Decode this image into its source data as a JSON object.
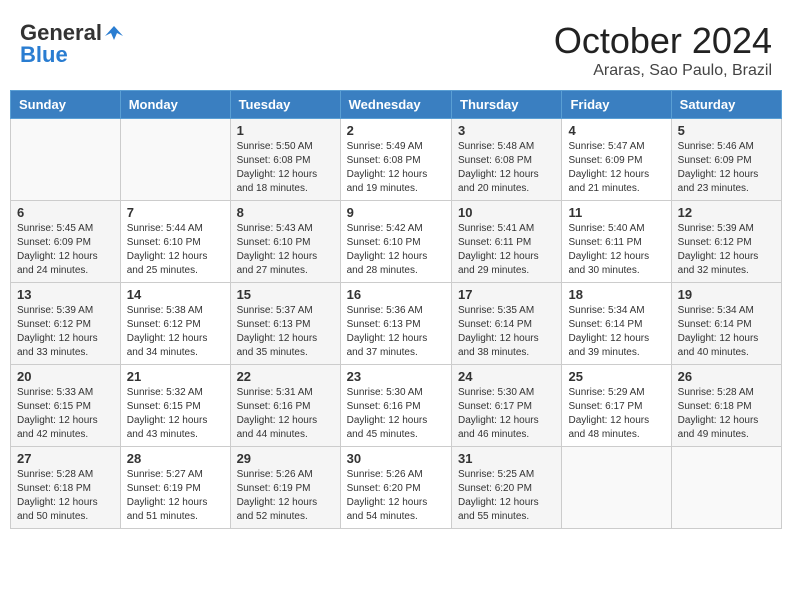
{
  "header": {
    "logo_general": "General",
    "logo_blue": "Blue",
    "month": "October 2024",
    "location": "Araras, Sao Paulo, Brazil"
  },
  "weekdays": [
    "Sunday",
    "Monday",
    "Tuesday",
    "Wednesday",
    "Thursday",
    "Friday",
    "Saturday"
  ],
  "weeks": [
    [
      {
        "day": "",
        "sunrise": "",
        "sunset": "",
        "daylight": ""
      },
      {
        "day": "",
        "sunrise": "",
        "sunset": "",
        "daylight": ""
      },
      {
        "day": "1",
        "sunrise": "Sunrise: 5:50 AM",
        "sunset": "Sunset: 6:08 PM",
        "daylight": "Daylight: 12 hours and 18 minutes."
      },
      {
        "day": "2",
        "sunrise": "Sunrise: 5:49 AM",
        "sunset": "Sunset: 6:08 PM",
        "daylight": "Daylight: 12 hours and 19 minutes."
      },
      {
        "day": "3",
        "sunrise": "Sunrise: 5:48 AM",
        "sunset": "Sunset: 6:08 PM",
        "daylight": "Daylight: 12 hours and 20 minutes."
      },
      {
        "day": "4",
        "sunrise": "Sunrise: 5:47 AM",
        "sunset": "Sunset: 6:09 PM",
        "daylight": "Daylight: 12 hours and 21 minutes."
      },
      {
        "day": "5",
        "sunrise": "Sunrise: 5:46 AM",
        "sunset": "Sunset: 6:09 PM",
        "daylight": "Daylight: 12 hours and 23 minutes."
      }
    ],
    [
      {
        "day": "6",
        "sunrise": "Sunrise: 5:45 AM",
        "sunset": "Sunset: 6:09 PM",
        "daylight": "Daylight: 12 hours and 24 minutes."
      },
      {
        "day": "7",
        "sunrise": "Sunrise: 5:44 AM",
        "sunset": "Sunset: 6:10 PM",
        "daylight": "Daylight: 12 hours and 25 minutes."
      },
      {
        "day": "8",
        "sunrise": "Sunrise: 5:43 AM",
        "sunset": "Sunset: 6:10 PM",
        "daylight": "Daylight: 12 hours and 27 minutes."
      },
      {
        "day": "9",
        "sunrise": "Sunrise: 5:42 AM",
        "sunset": "Sunset: 6:10 PM",
        "daylight": "Daylight: 12 hours and 28 minutes."
      },
      {
        "day": "10",
        "sunrise": "Sunrise: 5:41 AM",
        "sunset": "Sunset: 6:11 PM",
        "daylight": "Daylight: 12 hours and 29 minutes."
      },
      {
        "day": "11",
        "sunrise": "Sunrise: 5:40 AM",
        "sunset": "Sunset: 6:11 PM",
        "daylight": "Daylight: 12 hours and 30 minutes."
      },
      {
        "day": "12",
        "sunrise": "Sunrise: 5:39 AM",
        "sunset": "Sunset: 6:12 PM",
        "daylight": "Daylight: 12 hours and 32 minutes."
      }
    ],
    [
      {
        "day": "13",
        "sunrise": "Sunrise: 5:39 AM",
        "sunset": "Sunset: 6:12 PM",
        "daylight": "Daylight: 12 hours and 33 minutes."
      },
      {
        "day": "14",
        "sunrise": "Sunrise: 5:38 AM",
        "sunset": "Sunset: 6:12 PM",
        "daylight": "Daylight: 12 hours and 34 minutes."
      },
      {
        "day": "15",
        "sunrise": "Sunrise: 5:37 AM",
        "sunset": "Sunset: 6:13 PM",
        "daylight": "Daylight: 12 hours and 35 minutes."
      },
      {
        "day": "16",
        "sunrise": "Sunrise: 5:36 AM",
        "sunset": "Sunset: 6:13 PM",
        "daylight": "Daylight: 12 hours and 37 minutes."
      },
      {
        "day": "17",
        "sunrise": "Sunrise: 5:35 AM",
        "sunset": "Sunset: 6:14 PM",
        "daylight": "Daylight: 12 hours and 38 minutes."
      },
      {
        "day": "18",
        "sunrise": "Sunrise: 5:34 AM",
        "sunset": "Sunset: 6:14 PM",
        "daylight": "Daylight: 12 hours and 39 minutes."
      },
      {
        "day": "19",
        "sunrise": "Sunrise: 5:34 AM",
        "sunset": "Sunset: 6:14 PM",
        "daylight": "Daylight: 12 hours and 40 minutes."
      }
    ],
    [
      {
        "day": "20",
        "sunrise": "Sunrise: 5:33 AM",
        "sunset": "Sunset: 6:15 PM",
        "daylight": "Daylight: 12 hours and 42 minutes."
      },
      {
        "day": "21",
        "sunrise": "Sunrise: 5:32 AM",
        "sunset": "Sunset: 6:15 PM",
        "daylight": "Daylight: 12 hours and 43 minutes."
      },
      {
        "day": "22",
        "sunrise": "Sunrise: 5:31 AM",
        "sunset": "Sunset: 6:16 PM",
        "daylight": "Daylight: 12 hours and 44 minutes."
      },
      {
        "day": "23",
        "sunrise": "Sunrise: 5:30 AM",
        "sunset": "Sunset: 6:16 PM",
        "daylight": "Daylight: 12 hours and 45 minutes."
      },
      {
        "day": "24",
        "sunrise": "Sunrise: 5:30 AM",
        "sunset": "Sunset: 6:17 PM",
        "daylight": "Daylight: 12 hours and 46 minutes."
      },
      {
        "day": "25",
        "sunrise": "Sunrise: 5:29 AM",
        "sunset": "Sunset: 6:17 PM",
        "daylight": "Daylight: 12 hours and 48 minutes."
      },
      {
        "day": "26",
        "sunrise": "Sunrise: 5:28 AM",
        "sunset": "Sunset: 6:18 PM",
        "daylight": "Daylight: 12 hours and 49 minutes."
      }
    ],
    [
      {
        "day": "27",
        "sunrise": "Sunrise: 5:28 AM",
        "sunset": "Sunset: 6:18 PM",
        "daylight": "Daylight: 12 hours and 50 minutes."
      },
      {
        "day": "28",
        "sunrise": "Sunrise: 5:27 AM",
        "sunset": "Sunset: 6:19 PM",
        "daylight": "Daylight: 12 hours and 51 minutes."
      },
      {
        "day": "29",
        "sunrise": "Sunrise: 5:26 AM",
        "sunset": "Sunset: 6:19 PM",
        "daylight": "Daylight: 12 hours and 52 minutes."
      },
      {
        "day": "30",
        "sunrise": "Sunrise: 5:26 AM",
        "sunset": "Sunset: 6:20 PM",
        "daylight": "Daylight: 12 hours and 54 minutes."
      },
      {
        "day": "31",
        "sunrise": "Sunrise: 5:25 AM",
        "sunset": "Sunset: 6:20 PM",
        "daylight": "Daylight: 12 hours and 55 minutes."
      },
      {
        "day": "",
        "sunrise": "",
        "sunset": "",
        "daylight": ""
      },
      {
        "day": "",
        "sunrise": "",
        "sunset": "",
        "daylight": ""
      }
    ]
  ],
  "row_classes": [
    "row-white",
    "row-gray",
    "row-white",
    "row-gray",
    "row-white"
  ]
}
